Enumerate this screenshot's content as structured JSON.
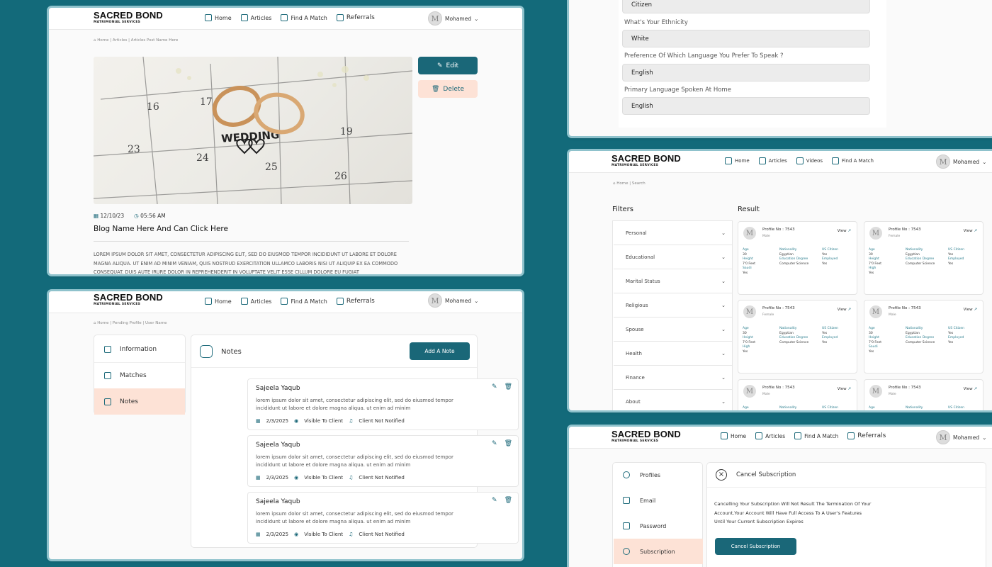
{
  "brand": {
    "name": "SACRED BOND",
    "sub": "MATRIMONIAL SERVICES"
  },
  "user": {
    "name": "Mohamed",
    "avatar": "M"
  },
  "panel_blog": {
    "menu": [
      "Home",
      "Articles",
      "Find A Match",
      "Referrals"
    ],
    "breadcrumb": "Home  |  Articles | Articles Post Name Here",
    "edit": "Edit",
    "delete": "Delete",
    "date": "12/10/23",
    "time": "05:56 AM",
    "title": "Blog Name Here And Can Click Here",
    "body": "LOREM IPSUM DOLOR SIT AMET, CONSECTETUR ADIPISCING ELIT, SED DO EIUSMOD TEMPOR INCIDIDUNT UT LABORE ET DOLORE MAGNA ALIQUA. UT ENIM AD MINIM VENIAM, QUIS NOSTRUD EXERCITATION ULLAMCO LABORIS NISI UT ALIQUIP EX EA COMMODO CONSEQUAT. DUIS AUTE IRURE DOLOR IN REPREHENDERIT IN VOLUPTATE VELIT ESSE CILLUM DOLORE EU FUGIAT",
    "image": {
      "calendar_numbers": [
        "16",
        "17",
        "19",
        "23",
        "24",
        "25",
        "26"
      ],
      "word": "WEDDING"
    }
  },
  "panel_notes": {
    "menu": [
      "Home",
      "Articles",
      "Find A Match",
      "Referrals"
    ],
    "breadcrumb": "Home  |  Pending Profile | User Name",
    "side": [
      "Information",
      "Matches",
      "Notes"
    ],
    "header": "Notes",
    "add": "Add A Note",
    "notes": [
      {
        "name": "Sajeela Yaqub",
        "text": "lorem ipsum dolor sit amet, consectetur adipiscing elit, sed do eiusmod tempor incididunt ut labore et dolore magna aliqua. ut enim ad minim",
        "date": "2/3/2025",
        "visible": "Visible To Client",
        "notified": "Client Not Notified"
      },
      {
        "name": "Sajeela Yaqub",
        "text": "lorem ipsum dolor sit amet, consectetur adipiscing elit, sed do eiusmod tempor incididunt ut labore et dolore magna aliqua. ut enim ad minim",
        "date": "2/3/2025",
        "visible": "Visible To Client",
        "notified": "Client Not Notified"
      },
      {
        "name": "Sajeela Yaqub",
        "text": "lorem ipsum dolor sit amet, consectetur adipiscing elit, sed do eiusmod tempor incididunt ut labore et dolore magna aliqua. ut enim ad minim",
        "date": "2/3/2025",
        "visible": "Visible To Client",
        "notified": "Client Not Notified"
      }
    ]
  },
  "panel_form": {
    "citizen": "Citizen",
    "q1": "What's Your Ethnicity",
    "a1": "White",
    "q2": "Preference Of Which Language You Prefer To Speak ?",
    "a2": "English",
    "q3": "Primary Language Spoken At Home",
    "a3": "English"
  },
  "panel_search": {
    "menu": [
      "Home",
      "Articles",
      "Videos",
      "Find A Match"
    ],
    "breadcrumb": "Home  |  Search",
    "filters_title": "Filters",
    "result_title": "Result",
    "filters": [
      "Personal",
      "Educational",
      "Marital Status",
      "Religious",
      "Spouse",
      "Health",
      "Finance",
      "About"
    ],
    "view": "View",
    "cards": [
      {
        "pn": "Profile No : 7543",
        "gender": "Male",
        "rows": [
          [
            "Age",
            "Nationality",
            "US Citizen"
          ],
          [
            "30",
            "Egyptian",
            "Yes"
          ],
          [
            "Height",
            "Education Degree",
            "Employed"
          ],
          [
            "7'0 Feet",
            "Computer Science",
            "Yes"
          ],
          [
            "Saudi",
            "",
            " "
          ],
          [
            "Yes",
            "",
            ""
          ]
        ]
      },
      {
        "pn": "Profile No : 7543",
        "gender": "Female",
        "rows": [
          [
            "Age",
            "Nationality",
            "US Citizen"
          ],
          [
            "30",
            "Egyptian",
            "Yes"
          ],
          [
            "Height",
            "Education Degree",
            "Employed"
          ],
          [
            "7'0 Feet",
            "Computer Science",
            "Yes"
          ],
          [
            "High",
            "",
            ""
          ],
          [
            "Yes",
            "",
            ""
          ]
        ]
      },
      {
        "pn": "Profile No : 7543",
        "gender": "Female",
        "rows": [
          [
            "Age",
            "Nationality",
            "US Citizen"
          ],
          [
            "30",
            "Egyptian",
            "Yes"
          ],
          [
            "Height",
            "Education Degree",
            "Employed"
          ],
          [
            "7'0 Feet",
            "Computer Science",
            "Yes"
          ],
          [
            "High",
            "",
            ""
          ],
          [
            "Yes",
            "",
            ""
          ]
        ]
      },
      {
        "pn": "Profile No : 7543",
        "gender": "Male",
        "rows": [
          [
            "Age",
            "Nationality",
            "US Citizen"
          ],
          [
            "30",
            "Egyptian",
            "Yes"
          ],
          [
            "Height",
            "Education Degree",
            "Employed"
          ],
          [
            "7'0 Feet",
            "Computer Science",
            "Yes"
          ],
          [
            "Saudi",
            "",
            ""
          ],
          [
            "Yes",
            "",
            ""
          ]
        ]
      },
      {
        "pn": "Profile No : 7543",
        "gender": "Male",
        "rows": [
          [
            "Age",
            "Nationality",
            "US Citizen"
          ]
        ]
      },
      {
        "pn": "Profile No : 7543",
        "gender": "Male",
        "rows": [
          [
            "Age",
            "Nationality",
            "US Citizen"
          ]
        ]
      }
    ]
  },
  "panel_sub": {
    "menu": [
      "Home",
      "Articles",
      "Find A Match",
      "Referrals"
    ],
    "side": [
      "Profiles",
      "Email",
      "Password",
      "Subscription"
    ],
    "header": "Cancel Subscription",
    "message": "Cancelling Your Subscription Will Not Result The Termination Of Your Account.Your Account Will Have Full Access To A User's Features Until Your Current Subscription Expires",
    "button": "Cancel Subscription"
  },
  "colors": {
    "bg": "#136a7a",
    "accent": "#1a6778",
    "peach": "#fde2d6"
  }
}
